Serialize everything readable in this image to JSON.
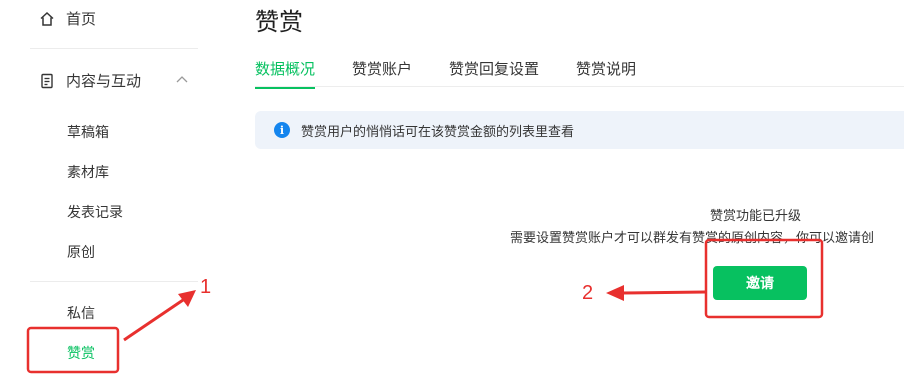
{
  "sidebar": {
    "home_label": "首页",
    "content_group_label": "内容与互动",
    "sub_items": [
      "草稿箱",
      "素材库",
      "发表记录",
      "原创"
    ],
    "messages_label": "私信",
    "reward_label": "赞赏"
  },
  "main": {
    "title": "赞赏",
    "tabs": [
      {
        "label": "数据概况",
        "active": true
      },
      {
        "label": "赞赏账户",
        "active": false
      },
      {
        "label": "赞赏回复设置",
        "active": false
      },
      {
        "label": "赞赏说明",
        "active": false
      }
    ],
    "info_banner": {
      "icon_letter": "i",
      "text": "赞赏用户的悄悄话可在该赞赏金额的列表里查看"
    },
    "upgrade": {
      "title": "赞赏功能已升级",
      "description": "需要设置赞赏账户才可以群发有赞赏的原创内容，你可以邀请创",
      "button_label": "邀请"
    }
  },
  "annotations": {
    "label_1": "1",
    "label_2": "2",
    "color": "#e8302e"
  },
  "colors": {
    "accent": "#07c160",
    "info": "#1485ee",
    "banner_bg": "#eef3fa"
  }
}
